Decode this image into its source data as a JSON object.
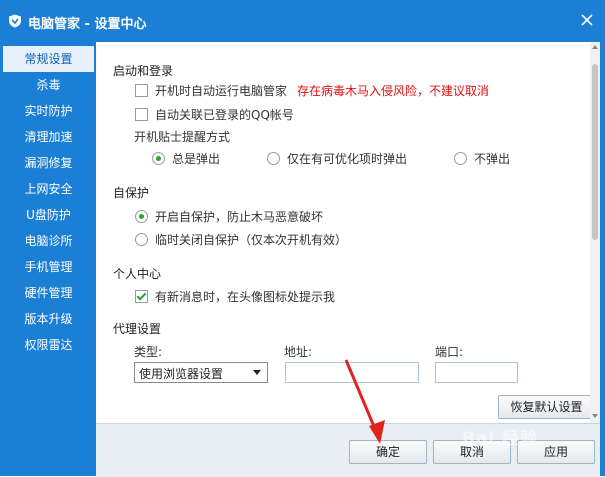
{
  "window": {
    "title": "电脑管家 - 设置中心",
    "accent_color": "#1b7fd6",
    "title_icon": "shield-icon",
    "close_icon": "close-icon"
  },
  "sidebar": {
    "items": [
      {
        "label": "常规设置",
        "active": true
      },
      {
        "label": "杀毒"
      },
      {
        "label": "实时防护"
      },
      {
        "label": "清理加速"
      },
      {
        "label": "漏洞修复"
      },
      {
        "label": "上网安全"
      },
      {
        "label": "U盘防护"
      },
      {
        "label": "电脑诊所"
      },
      {
        "label": "手机管理"
      },
      {
        "label": "硬件管理"
      },
      {
        "label": "版本升级"
      },
      {
        "label": "权限雷达"
      }
    ]
  },
  "startup": {
    "title": "启动和登录",
    "autostart_label": "开机时自动运行电脑管家",
    "autostart_checked": false,
    "autostart_warning": "存在病毒木马入侵风险，不建议取消",
    "warning_color": "#e01010",
    "qq_label": "自动关联已登录的QQ帐号",
    "qq_checked": false,
    "tip_title": "开机贴士提醒方式",
    "tip_options": [
      "总是弹出",
      "仅在有可优化项时弹出",
      "不弹出"
    ],
    "tip_selected": "总是弹出"
  },
  "selfprotect": {
    "title": "自保护",
    "options": [
      "开启自保护，防止木马恶意破坏",
      "临时关闭自保护（仅本次开机有效）"
    ],
    "selected": "开启自保护，防止木马恶意破坏"
  },
  "personal": {
    "title": "个人中心",
    "notify_label": "有新消息时，在头像图标处提示我",
    "notify_checked": true
  },
  "proxy": {
    "title": "代理设置",
    "type_label": "类型:",
    "address_label": "地址:",
    "port_label": "端口:",
    "type_value": "使用浏览器设置",
    "address_value": "",
    "port_value": "",
    "restore_button": "恢复默认设置"
  },
  "footer": {
    "ok_label": "确定",
    "cancel_label": "取消",
    "apply_label": "应用"
  },
  "watermark": "Bai 经验"
}
